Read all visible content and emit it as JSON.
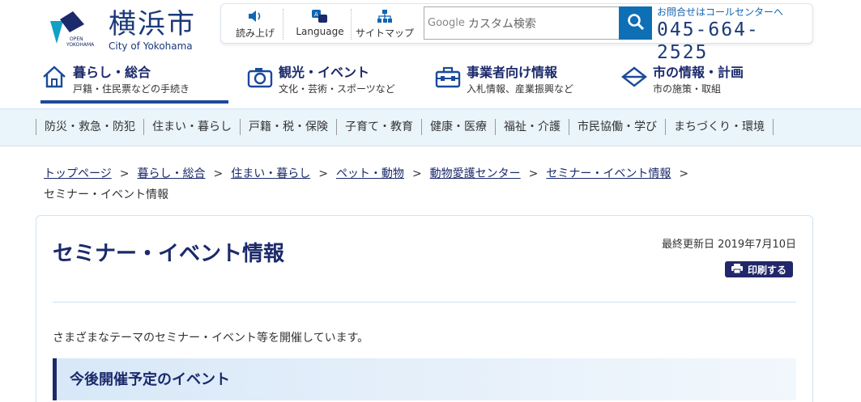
{
  "logo": {
    "kanji": "横浜市",
    "english": "City of Yokohama",
    "mark_text_1": "OPEN",
    "mark_text_2": "YOKOHAMA"
  },
  "utility": {
    "read_aloud": "読み上げ",
    "language": "Language",
    "sitemap": "サイトマップ"
  },
  "search": {
    "google_label": "Google",
    "placeholder": "カスタム検索"
  },
  "callcenter": {
    "label": "お問合せはコールセンターへ",
    "tel": "045-664-2525"
  },
  "mainnav": [
    {
      "title": "暮らし・総合",
      "sub": "戸籍・住民票などの手続き",
      "icon": "house-icon"
    },
    {
      "title": "観光・イベント",
      "sub": "文化・芸術・スポーツなど",
      "icon": "camera-icon"
    },
    {
      "title": "事業者向け情報",
      "sub": "入札情報、産業振興など",
      "icon": "briefcase-icon"
    },
    {
      "title": "市の情報・計画",
      "sub": "市の施策・取組",
      "icon": "diamond-icon"
    }
  ],
  "categories": [
    "防災・救急・防犯",
    "住まい・暮らし",
    "戸籍・税・保険",
    "子育て・教育",
    "健康・医療",
    "福祉・介護",
    "市民協働・学び",
    "まちづくり・環境"
  ],
  "breadcrumb": {
    "links": [
      "トップページ",
      "暮らし・総合",
      "住まい・暮らし",
      "ペット・動物",
      "動物愛護センター",
      "セミナー・イベント情報"
    ],
    "separator": ">",
    "current": "セミナー・イベント情報"
  },
  "content": {
    "title": "セミナー・イベント情報",
    "updated": "最終更新日 2019年7月10日",
    "print_label": "印刷する",
    "intro": "さまざまなテーマのセミナー・イベント等を開催しています。",
    "section_heading": "今後開催予定のイベント"
  },
  "colors": {
    "navy": "#1b2a6b",
    "blue": "#0f6fb5",
    "light_bg": "#eaf4fb"
  }
}
